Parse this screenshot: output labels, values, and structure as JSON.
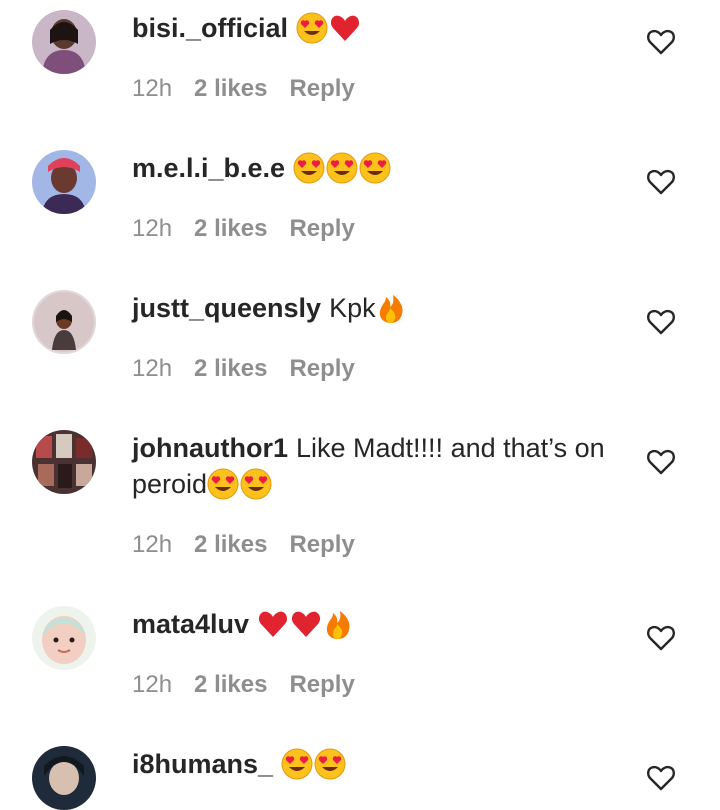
{
  "colors": {
    "text_primary": "#262626",
    "text_secondary": "#8e8e8e",
    "heart_red": "#e0232e",
    "emoji_yellow": "#fcc21b",
    "fire_orange": "#f57c00"
  },
  "comments": [
    {
      "username": "bisi._official",
      "text_lines": [
        {
          "text": "",
          "emojis": [
            "heart-eyes-emoji",
            "red-heart-emoji"
          ]
        }
      ],
      "time": "12h",
      "likes": "2 likes",
      "reply": "Reply"
    },
    {
      "username": "m.e.l.i_b.e.e",
      "text_lines": [
        {
          "text": "",
          "emojis": [
            "heart-eyes-emoji",
            "heart-eyes-emoji",
            "heart-eyes-emoji"
          ]
        }
      ],
      "time": "12h",
      "likes": "2 likes",
      "reply": "Reply"
    },
    {
      "username": "justt_queensly",
      "text_lines": [
        {
          "text": "Kpk",
          "emojis": [
            "fire-emoji"
          ]
        }
      ],
      "time": "12h",
      "likes": "2 likes",
      "reply": "Reply"
    },
    {
      "username": "johnauthor1",
      "text_lines": [
        {
          "text": "Like Madt!!!! and that’s on",
          "emojis": []
        },
        {
          "text": "peroid",
          "emojis": [
            "heart-eyes-emoji",
            "heart-eyes-emoji"
          ]
        }
      ],
      "time": "12h",
      "likes": "2 likes",
      "reply": "Reply"
    },
    {
      "username": "mata4luv",
      "text_lines": [
        {
          "text": "",
          "emojis": [
            "red-heart-emoji",
            "red-heart-emoji",
            "fire-emoji"
          ]
        }
      ],
      "time": "12h",
      "likes": "2 likes",
      "reply": "Reply"
    },
    {
      "username": "i8humans_",
      "text_lines": [
        {
          "text": "",
          "emojis": [
            "heart-eyes-emoji",
            "heart-eyes-emoji"
          ]
        }
      ],
      "time": "",
      "likes": "",
      "reply": ""
    }
  ],
  "icons": {
    "like": "heart-outline-icon"
  }
}
